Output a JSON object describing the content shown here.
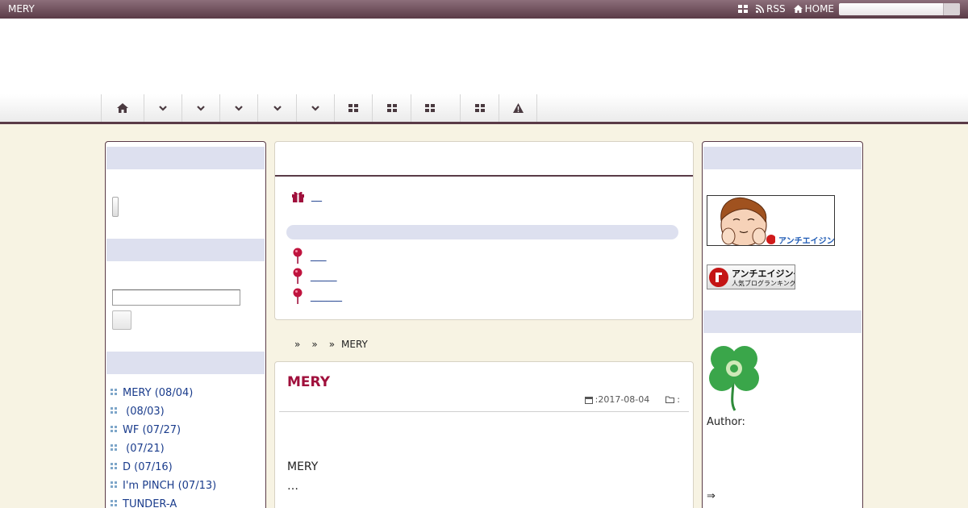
{
  "topbar": {
    "site_title": "MERY",
    "rss_label": "RSS",
    "home_label": "HOME",
    "search_placeholder": ""
  },
  "nav": {
    "items": [
      {
        "icon": "home-icon"
      },
      {
        "icon": "chevron-down-icon"
      },
      {
        "icon": "chevron-down-icon"
      },
      {
        "icon": "chevron-down-icon"
      },
      {
        "icon": "chevron-down-icon"
      },
      {
        "icon": "chevron-down-icon"
      },
      {
        "icon": "grid-icon"
      },
      {
        "icon": "grid-icon"
      },
      {
        "icon": "grid-icon"
      },
      {
        "icon": "grid-icon"
      },
      {
        "icon": "warning-icon"
      }
    ]
  },
  "left_sidebar": {
    "search_value": "",
    "entries": [
      "MERY (08/04)",
      " (08/03)",
      "WF (07/27)",
      " (07/21)",
      "D (07/16)",
      "I'm PINCH (07/13)",
      "TUNDER-A"
    ]
  },
  "center_top": {
    "gift_link": "__",
    "links": [
      "___",
      "_____",
      "______"
    ]
  },
  "breadcrumb": {
    "separator": "»",
    "current": "MERY"
  },
  "article": {
    "title": "MERY",
    "date": ":2017-08-04",
    "category": ":",
    "body_line1": "MERY",
    "body_line2": "…"
  },
  "right_sidebar": {
    "banner1_text": "アンチエイジング",
    "banner2_text_line1": "アンチエイジング",
    "banner2_text_line2": "人気ブログランキング",
    "author_label": "Author:",
    "arrow_text": "⇒"
  },
  "colors": {
    "accent": "#5a3b47",
    "title": "#a0103c",
    "link": "#1a3c8c",
    "sidebar_head": "#dde0ef",
    "background": "#f7f3e3"
  }
}
